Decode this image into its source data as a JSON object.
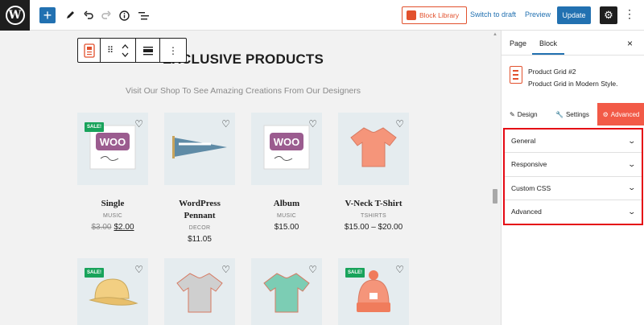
{
  "topbar": {
    "block_library_label": "Block Library",
    "switch_to_draft_label": "Switch to draft",
    "preview_label": "Preview",
    "update_label": "Update"
  },
  "canvas": {
    "heading": "EXCLUSIVE PRODUCTS",
    "subheading": "Visit Our Shop To See Amazing Creations From Our Designers",
    "products": [
      {
        "name": "Single",
        "category": "MUSIC",
        "old_price": "$3.00",
        "price": "$2.00",
        "sale": "SALE!",
        "image": "woo-album-icon"
      },
      {
        "name": "WordPress Pennant",
        "category": "DECOR",
        "price": "$11.05",
        "image": "pennant-icon"
      },
      {
        "name": "Album",
        "category": "MUSIC",
        "price": "$15.00",
        "image": "woo-album-icon"
      },
      {
        "name": "V-Neck T-Shirt",
        "category": "TSHIRTS",
        "price": "$15.00 – $20.00",
        "image": "tshirt-icon"
      },
      {
        "sale": "SALE!",
        "image": "cap-icon"
      },
      {
        "image": "tshirt-icon"
      },
      {
        "image": "tshirt-icon"
      },
      {
        "sale": "SALE!",
        "image": "beanie-icon"
      }
    ]
  },
  "sidebar": {
    "tabs": [
      "Page",
      "Block"
    ],
    "close_label": "×",
    "block_title": "Product Grid #2",
    "block_desc": "Product Grid in Modern Style.",
    "section_tabs": [
      "Design",
      "Settings",
      "Advanced"
    ],
    "panels": [
      "General",
      "Responsive",
      "Custom CSS",
      "Advanced"
    ]
  },
  "colors": {
    "accent": "#2271b1",
    "brand_orange": "#e2512d",
    "active_tab": "#f25a47",
    "sale_green": "#18a35b",
    "highlight_red": "#e50914"
  }
}
